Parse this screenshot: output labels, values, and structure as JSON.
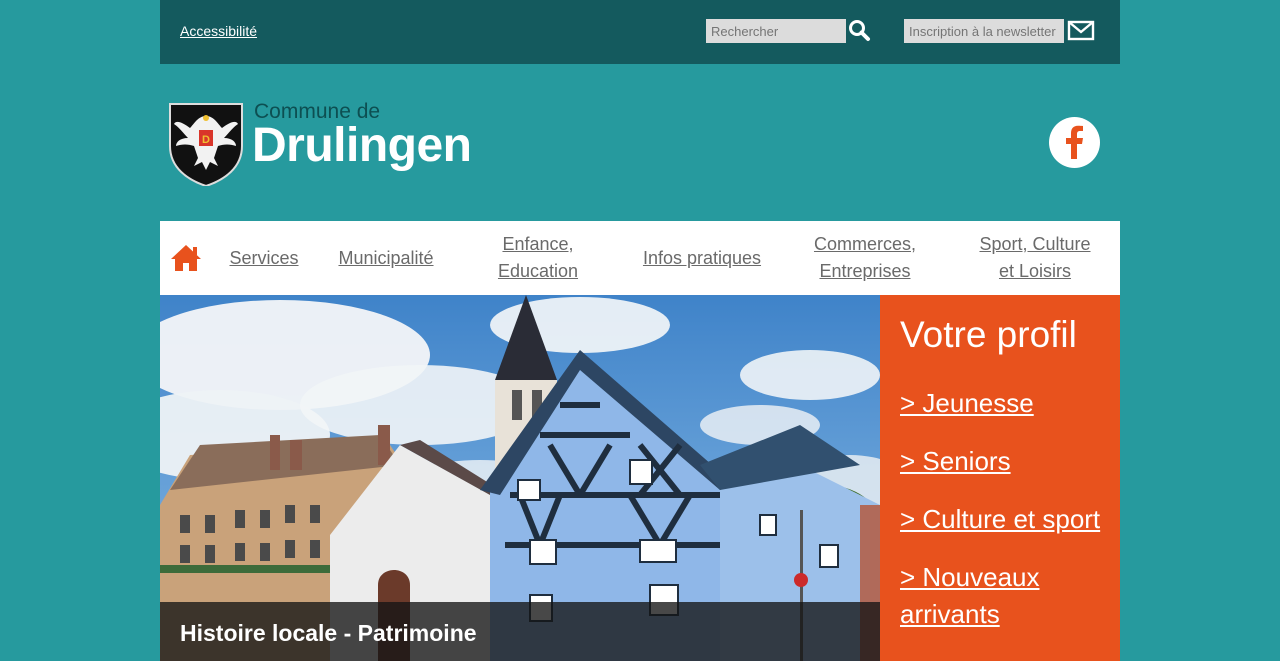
{
  "topbar": {
    "accessibility_label": "Accessibilité",
    "search_placeholder": "Rechercher",
    "newsletter_placeholder": "Inscription à la newsletter",
    "search_icon": "search-icon",
    "newsletter_icon": "envelope-icon"
  },
  "header": {
    "logo_prefix": "Commune de",
    "logo_name": "Drulingen",
    "social_icon": "facebook-icon"
  },
  "nav": {
    "home_icon": "home-icon",
    "items": [
      {
        "label": "Services"
      },
      {
        "label": "Municipalité"
      },
      {
        "label": "Enfance,\nEducation"
      },
      {
        "label": "Infos pratiques"
      },
      {
        "label": "Commerces,\nEntreprises"
      },
      {
        "label": "Sport, Culture\net Loisirs"
      }
    ]
  },
  "hero": {
    "caption": "Histoire locale - Patrimoine"
  },
  "profile": {
    "title": "Votre profil",
    "links": [
      {
        "label": "> Jeunesse"
      },
      {
        "label": "> Seniors"
      },
      {
        "label": "> Culture et sport"
      },
      {
        "label": "> Nouveaux arrivants"
      }
    ]
  },
  "colors": {
    "background": "#269a9e",
    "topbar": "#145a5e",
    "accent": "#e8521d",
    "nav_text": "#6a6a6a"
  }
}
